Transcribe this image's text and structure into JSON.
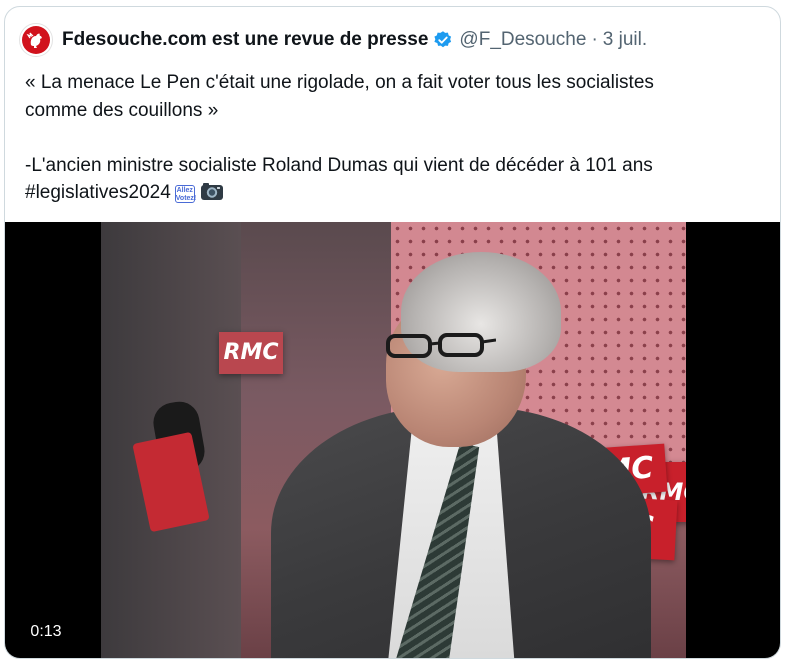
{
  "tweet": {
    "display_name": "Fdesouche.com est une revue de presse",
    "handle": "@F_Desouche",
    "separator": "·",
    "date": "3 juil.",
    "text_line_1": "« La menace Le Pen c'était une rigolade, on a fait voter tous les socialistes",
    "text_line_2": "comme des couillons »",
    "text_line_3": "-L'ancien ministre socialiste Roland Dumas qui vient de décéder à 101 ans",
    "hashtag": "#legislatives2024",
    "vote_emoji_text": "Allez Votez!"
  },
  "video": {
    "timestamp": "0:13",
    "signs": [
      "RMC",
      "RMC",
      "RMC",
      "RMC"
    ]
  },
  "icons": {
    "avatar": "rooster-icon",
    "verified": "verified-badge-icon",
    "vote": "vote-emoji-icon",
    "camera": "camera-emoji-icon"
  },
  "colors": {
    "avatar_bg": "#d1121c",
    "verified": "#1d9bf0",
    "text_primary": "#0f1419",
    "text_secondary": "#536471",
    "border": "#cfd9de"
  }
}
